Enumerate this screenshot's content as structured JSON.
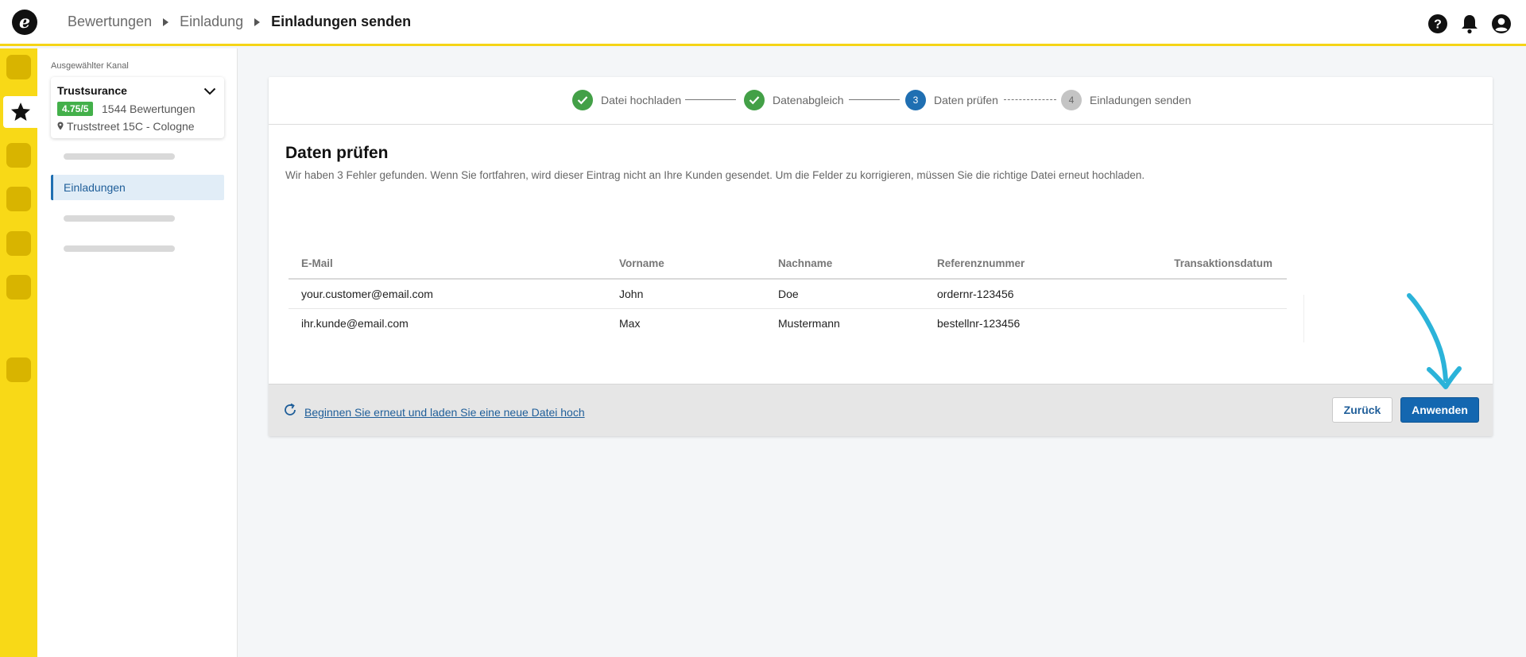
{
  "header": {
    "breadcrumb": [
      "Bewertungen",
      "Einladung",
      "Einladungen senden"
    ],
    "icons": [
      "help-icon",
      "bell-icon",
      "account-icon"
    ]
  },
  "sidebar": {
    "caption": "Ausgewählter Kanal",
    "channel": {
      "name": "Trustsurance",
      "rating": "4.75/5",
      "reviews": "1544 Bewertungen",
      "address": "Truststreet 15C - Cologne"
    },
    "active_item": "Einladungen"
  },
  "stepper": {
    "steps": [
      {
        "label": "Datei hochladen",
        "state": "done"
      },
      {
        "label": "Datenabgleich",
        "state": "done"
      },
      {
        "label": "Daten prüfen",
        "number": "3",
        "state": "active"
      },
      {
        "label": "Einladungen senden",
        "number": "4",
        "state": "pending"
      }
    ]
  },
  "main": {
    "title": "Daten prüfen",
    "description": "Wir haben 3 Fehler gefunden. Wenn Sie fortfahren, wird dieser Eintrag nicht an Ihre Kunden gesendet. Um die Felder zu korrigieren, müssen Sie die richtige Datei erneut hochladen."
  },
  "table": {
    "columns": [
      "E-Mail",
      "Vorname",
      "Nachname",
      "Referenznummer",
      "Transaktionsdatum"
    ],
    "rows": [
      [
        "your.customer@email.com",
        "John",
        "Doe",
        "ordernr-123456",
        ""
      ],
      [
        "ihr.kunde@email.com",
        "Max",
        "Mustermann",
        "bestellnr-123456",
        ""
      ]
    ]
  },
  "footer": {
    "restart_link": "Beginnen Sie erneut und laden Sie eine neue Datei hoch",
    "back_label": "Zurück",
    "apply_label": "Anwenden"
  },
  "colors": {
    "brand_yellow": "#f8d917",
    "primary_blue": "#1467b0",
    "success_green": "#43a047",
    "annotation_cyan": "#2bb3d9"
  }
}
